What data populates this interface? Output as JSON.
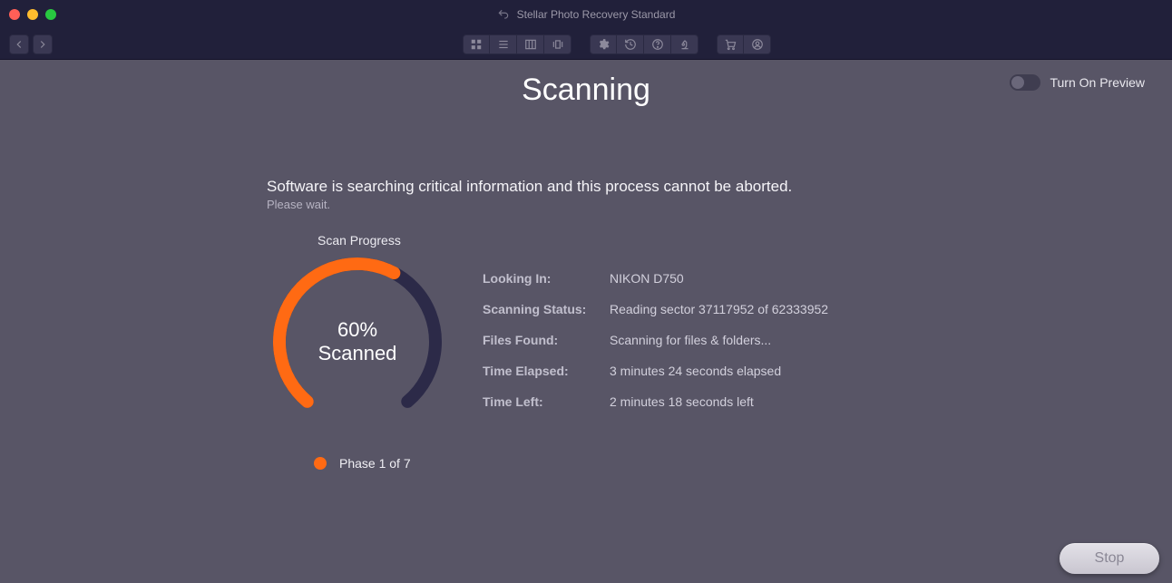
{
  "window": {
    "title": "Stellar Photo Recovery Standard"
  },
  "header": {
    "page_title": "Scanning",
    "preview_toggle_label": "Turn On Preview"
  },
  "status": {
    "primary": "Software is searching critical information and this process cannot be aborted.",
    "secondary": "Please wait.",
    "scan_progress_label": "Scan Progress",
    "percent_text": "60%",
    "scanned_text": "Scanned",
    "phase_text": "Phase 1 of 7"
  },
  "info": {
    "looking_in": {
      "label": "Looking In:",
      "value": "NIKON D750"
    },
    "scanning_status": {
      "label": "Scanning Status:",
      "value": "Reading sector 37117952 of 62333952"
    },
    "files_found": {
      "label": "Files Found:",
      "value": "Scanning for files & folders..."
    },
    "time_elapsed": {
      "label": "Time Elapsed:",
      "value": "3 minutes 24 seconds elapsed"
    },
    "time_left": {
      "label": "Time Left:",
      "value": "2 minutes 18 seconds left"
    }
  },
  "footer": {
    "stop_label": "Stop"
  },
  "chart_data": {
    "type": "gauge",
    "title": "Scan Progress",
    "value_percent": 60,
    "arc_start_deg": 130,
    "arc_sweep_deg": 280,
    "series": [
      {
        "name": "Scanned",
        "color": "#ff6a13"
      },
      {
        "name": "Remaining",
        "color": "#2c2a48"
      }
    ]
  }
}
